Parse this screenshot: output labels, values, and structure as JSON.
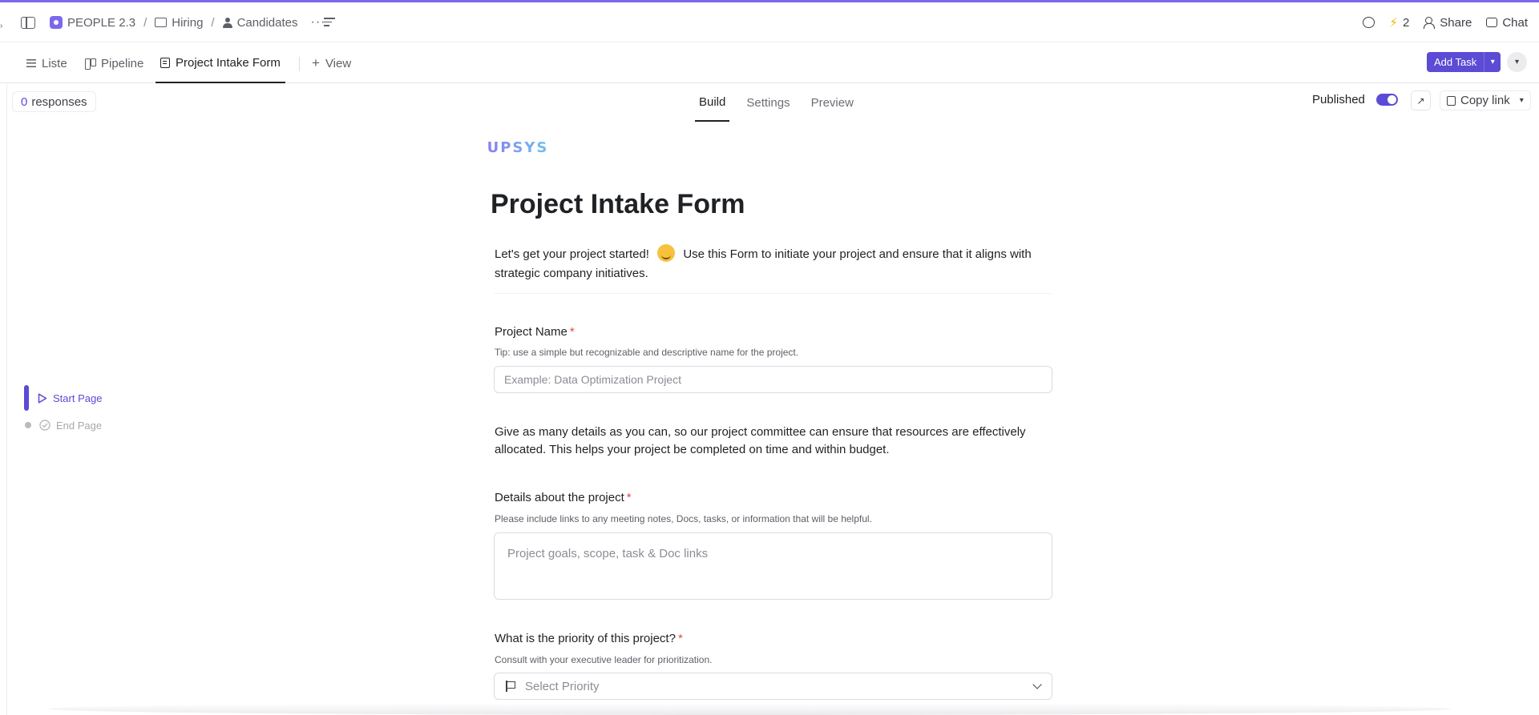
{
  "colors": {
    "accent": "#7b68ee",
    "primary_button": "#5b4bd5",
    "required": "#e5484d"
  },
  "breadcrumb": {
    "space": "PEOPLE 2.3",
    "folder": "Hiring",
    "list": "Candidates",
    "more": "···"
  },
  "topbar": {
    "automation_count": "2",
    "share_label": "Share",
    "chat_label": "Chat"
  },
  "views": {
    "tabs": [
      {
        "label": "Liste",
        "icon": "list-icon"
      },
      {
        "label": "Pipeline",
        "icon": "board-icon"
      },
      {
        "label": "Project Intake Form",
        "icon": "form-icon",
        "active": true
      }
    ],
    "add_view_label": "View",
    "add_task_label": "Add Task"
  },
  "subbar": {
    "responses_count": "0",
    "responses_label": "responses",
    "tabs": [
      "Build",
      "Settings",
      "Preview"
    ],
    "active_tab": "Build",
    "published_label": "Published",
    "published_on": true,
    "copy_link_label": "Copy link"
  },
  "pages": {
    "start": "Start Page",
    "end": "End Page"
  },
  "form": {
    "logo_text": "UPSYS",
    "title": "Project Intake Form",
    "intro_before_emoji": "Let's get your project started!",
    "intro_after_emoji": "Use this Form to initiate your project and ensure that it aligns with strategic company initiatives.",
    "fields": {
      "project_name": {
        "label": "Project Name",
        "required_mark": "*",
        "tip": "Tip: use a simple but recognizable and descriptive name for the project.",
        "placeholder": "Example: Data Optimization Project"
      },
      "details_paragraph": "Give as many details as you can, so our project committee can ensure that resources are effectively allocated. This helps your project be completed on time and within budget.",
      "details": {
        "label": "Details about the project",
        "required_mark": "*",
        "tip": "Please include links to any meeting notes, Docs, tasks, or information that will be helpful.",
        "placeholder": "Project goals, scope, task & Doc links"
      },
      "priority": {
        "label": "What is the priority of this project?",
        "required_mark": "*",
        "tip": "Consult with your executive leader for prioritization.",
        "placeholder": "Select Priority"
      }
    }
  }
}
